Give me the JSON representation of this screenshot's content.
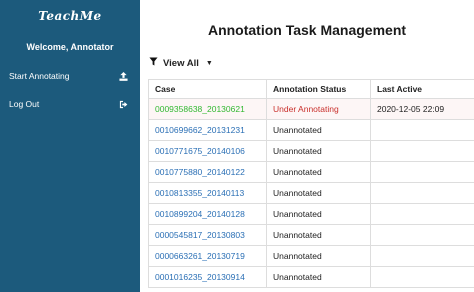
{
  "brand": {
    "logo_text": "TeachMe"
  },
  "sidebar": {
    "welcome": "Welcome, Annotator",
    "items": [
      {
        "label": "Start Annotating",
        "icon": "upload-icon"
      },
      {
        "label": "Log Out",
        "icon": "sign-out-icon"
      }
    ],
    "background": "#1c5a7c"
  },
  "main": {
    "title": "Annotation Task Management",
    "filter": {
      "label": "View All",
      "icon": "filter-icon"
    },
    "table": {
      "headers": [
        "Case",
        "Annotation Status",
        "Last Active"
      ],
      "rows": [
        {
          "case": "0009358638_20130621",
          "status": "Under Annotating",
          "last_active": "2020-12-05 22:09"
        },
        {
          "case": "0010699662_20131231",
          "status": "Unannotated",
          "last_active": ""
        },
        {
          "case": "0010771675_20140106",
          "status": "Unannotated",
          "last_active": ""
        },
        {
          "case": "0010775880_20140122",
          "status": "Unannotated",
          "last_active": ""
        },
        {
          "case": "0010813355_20140113",
          "status": "Unannotated",
          "last_active": ""
        },
        {
          "case": "0010899204_20140128",
          "status": "Unannotated",
          "last_active": ""
        },
        {
          "case": "0000545817_20130803",
          "status": "Unannotated",
          "last_active": ""
        },
        {
          "case": "0000663261_20130719",
          "status": "Unannotated",
          "last_active": ""
        },
        {
          "case": "0001016235_20130914",
          "status": "Unannotated",
          "last_active": ""
        }
      ]
    }
  },
  "colors": {
    "link": "#2a6fb5",
    "current_case": "#32b832",
    "current_status": "#c9302c"
  }
}
